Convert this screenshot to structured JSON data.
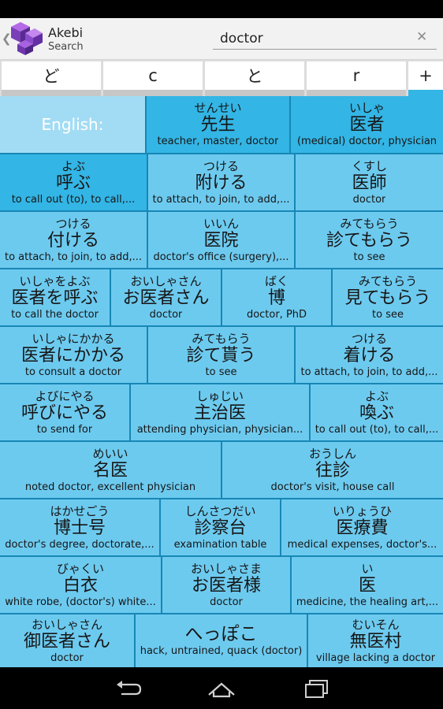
{
  "app": {
    "title": "Akebi",
    "subtitle": "Search",
    "search_value": "doctor",
    "search_placeholder": "Search"
  },
  "icons": {
    "up": "chevron-left-icon",
    "clear": "close-icon",
    "logo": "akebi-logo",
    "nav": [
      "back-icon",
      "home-icon",
      "recents-icon"
    ]
  },
  "colors": {
    "accent": "#33b5e5",
    "tile": "#6dcaef",
    "label_tile": "#a2dcf4",
    "grid_gap": "#1787b5"
  },
  "keys": [
    "ど",
    "c",
    "と",
    "r",
    "+"
  ],
  "label": "English:",
  "results": [
    {
      "reading": "せんせい",
      "kanji": "先生",
      "gloss": "teacher, master, doctor"
    },
    {
      "reading": "いしゃ",
      "kanji": "医者",
      "gloss": "(medical) doctor, physician"
    },
    {
      "reading": "よぶ",
      "kanji": "呼ぶ",
      "gloss": "to call out (to), to call,..."
    },
    {
      "reading": "つける",
      "kanji": "附ける",
      "gloss": "to attach, to join, to add,..."
    },
    {
      "reading": "くすし",
      "kanji": "医師",
      "gloss": "doctor"
    },
    {
      "reading": "つける",
      "kanji": "付ける",
      "gloss": "to attach, to join, to add,..."
    },
    {
      "reading": "いいん",
      "kanji": "医院",
      "gloss": "doctor's office (surgery),..."
    },
    {
      "reading": "みてもらう",
      "kanji": "診てもらう",
      "gloss": "to see"
    },
    {
      "reading": "いしゃをよぶ",
      "kanji": "医者を呼ぶ",
      "gloss": "to call the doctor"
    },
    {
      "reading": "おいしゃさん",
      "kanji": "お医者さん",
      "gloss": "doctor"
    },
    {
      "reading": "ばく",
      "kanji": "博",
      "gloss": "doctor, PhD"
    },
    {
      "reading": "みてもらう",
      "kanji": "見てもらう",
      "gloss": "to see"
    },
    {
      "reading": "いしゃにかかる",
      "kanji": "医者にかかる",
      "gloss": "to consult a doctor"
    },
    {
      "reading": "みてもらう",
      "kanji": "診て貰う",
      "gloss": "to see"
    },
    {
      "reading": "つける",
      "kanji": "着ける",
      "gloss": "to attach, to join, to add,..."
    },
    {
      "reading": "よびにやる",
      "kanji": "呼びにやる",
      "gloss": "to send for"
    },
    {
      "reading": "しゅじい",
      "kanji": "主治医",
      "gloss": "attending physician, physician..."
    },
    {
      "reading": "よぶ",
      "kanji": "喚ぶ",
      "gloss": "to call out (to), to call,..."
    },
    {
      "reading": "めいい",
      "kanji": "名医",
      "gloss": "noted doctor, excellent physician"
    },
    {
      "reading": "おうしん",
      "kanji": "往診",
      "gloss": "doctor's visit, house call"
    },
    {
      "reading": "はかせごう",
      "kanji": "博士号",
      "gloss": "doctor's degree, doctorate,..."
    },
    {
      "reading": "しんさつだい",
      "kanji": "診察台",
      "gloss": "examination table"
    },
    {
      "reading": "いりょうひ",
      "kanji": "医療費",
      "gloss": "medical expenses, doctor's..."
    },
    {
      "reading": "びゃくい",
      "kanji": "白衣",
      "gloss": "white robe, (doctor's) white..."
    },
    {
      "reading": "おいしゃさま",
      "kanji": "お医者様",
      "gloss": "doctor"
    },
    {
      "reading": "い",
      "kanji": "医",
      "gloss": "medicine, the healing art,..."
    },
    {
      "reading": "おいしゃさん",
      "kanji": "御医者さん",
      "gloss": "doctor"
    },
    {
      "reading": "",
      "kanji": "へっぽこ",
      "gloss": "hack, untrained, quack (doctor)"
    },
    {
      "reading": "むいそん",
      "kanji": "無医村",
      "gloss": "village lacking a doctor"
    }
  ]
}
